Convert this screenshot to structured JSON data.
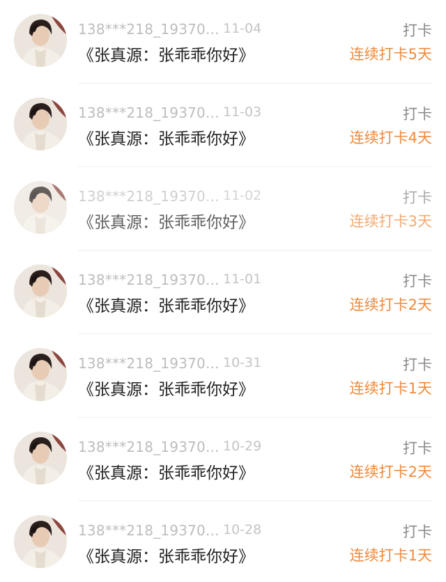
{
  "records": [
    {
      "user": "138***218_19370...",
      "date": "11-04",
      "action": "打卡",
      "title": "《张真源：张乖乖你好》",
      "streak": "连续打卡5天",
      "faded": false
    },
    {
      "user": "138***218_19370...",
      "date": "11-03",
      "action": "打卡",
      "title": "《张真源：张乖乖你好》",
      "streak": "连续打卡4天",
      "faded": false
    },
    {
      "user": "138***218_19370...",
      "date": "11-02",
      "action": "打卡",
      "title": "《张真源：张乖乖你好》",
      "streak": "连续打卡3天",
      "faded": true
    },
    {
      "user": "138***218_19370...",
      "date": "11-01",
      "action": "打卡",
      "title": "《张真源：张乖乖你好》",
      "streak": "连续打卡2天",
      "faded": false
    },
    {
      "user": "138***218_19370...",
      "date": "10-31",
      "action": "打卡",
      "title": "《张真源：张乖乖你好》",
      "streak": "连续打卡1天",
      "faded": false
    },
    {
      "user": "138***218_19370...",
      "date": "10-29",
      "action": "打卡",
      "title": "《张真源：张乖乖你好》",
      "streak": "连续打卡2天",
      "faded": false
    },
    {
      "user": "138***218_19370...",
      "date": "10-28",
      "action": "打卡",
      "title": "《张真源：张乖乖你好》",
      "streak": "连续打卡1天",
      "faded": false
    }
  ],
  "colors": {
    "streak_accent": "#f08a3b",
    "muted_text": "#bdbdbd",
    "primary_text": "#222222"
  },
  "icons": {
    "avatar": "user-avatar-photo"
  }
}
